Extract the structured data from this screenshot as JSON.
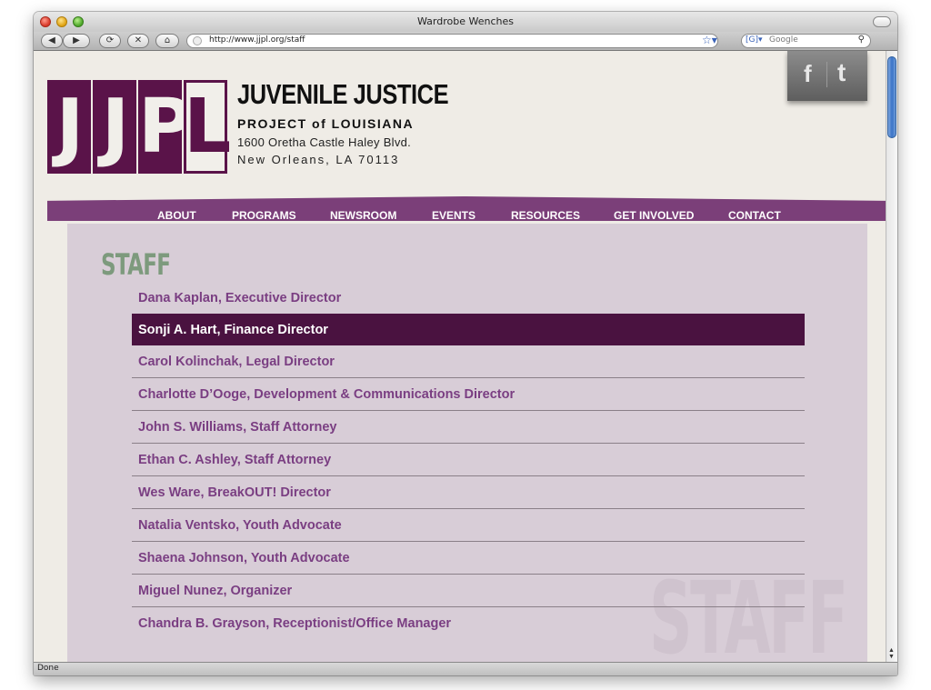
{
  "window": {
    "title": "Wardrobe Wenches",
    "status": "Done"
  },
  "toolbar": {
    "back": "◀",
    "forward": "▶",
    "reload": "⟳",
    "stop": "✕",
    "home": "⌂",
    "url": "http://www.jjpl.org/staff",
    "search_engine": "G",
    "search_placeholder": "Google",
    "search_icon": "magnifier-icon",
    "bookmark_icon": "star-icon"
  },
  "header": {
    "logo_letters": [
      "J",
      "J",
      "P",
      "L"
    ],
    "org_name": "JUVENILE JUSTICE",
    "org_subtitle": "PROJECT of LOUISIANA",
    "address_line1": "1600 Oretha Castle Haley Blvd.",
    "address_line2": "New Orleans, LA 70113",
    "social": {
      "facebook": "f",
      "twitter": "t"
    }
  },
  "nav": {
    "items": [
      "ABOUT",
      "PROGRAMS",
      "NEWSROOM",
      "EVENTS",
      "RESOURCES",
      "GET INVOLVED",
      "CONTACT"
    ]
  },
  "main": {
    "heading": "STAFF",
    "watermark": "STAFF",
    "staff": [
      "Dana Kaplan, Executive Director",
      "Sonji A. Hart, Finance Director",
      "Carol Kolinchak, Legal Director",
      "Charlotte D’Ooge, Development & Communications Director",
      "John S. Williams, Staff Attorney",
      "Ethan C. Ashley, Staff Attorney",
      "Wes Ware, BreakOUT! Director",
      "Natalia Ventsko, Youth Advocate",
      "Shaena Johnson, Youth Advocate",
      "Miguel Nunez, Organizer",
      "Chandra B. Grayson, Receptionist/Office Manager"
    ],
    "active_index": 1
  },
  "colors": {
    "brand_purple": "#5a1349",
    "nav_purple": "#7b3f79",
    "link_purple": "#7a3e82",
    "active_row": "#4a1240",
    "panel": "#d8cdd7",
    "heading_green": "#7d9a7d"
  }
}
